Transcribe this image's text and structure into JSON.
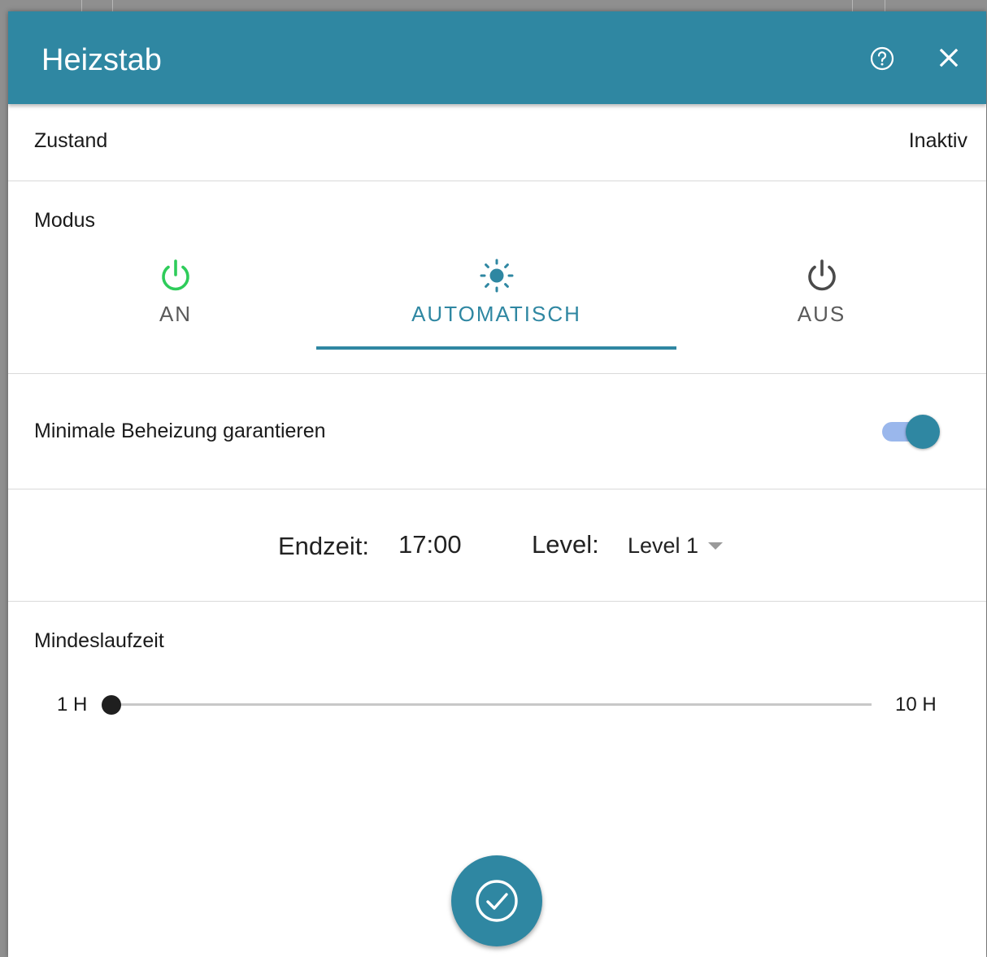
{
  "dialog": {
    "title": "Heizstab",
    "help_icon": "help-circle-icon",
    "close_icon": "close-icon"
  },
  "state": {
    "label": "Zustand",
    "value": "Inaktiv"
  },
  "mode": {
    "label": "Modus",
    "tabs": [
      {
        "label": "AN",
        "icon": "power-icon",
        "icon_color": "#2ecc5a"
      },
      {
        "label": "AUTOMATISCH",
        "icon": "sun-icon",
        "icon_color": "#2f87a2",
        "selected": true
      },
      {
        "label": "AUS",
        "icon": "power-icon",
        "icon_color": "#4a4a4a"
      }
    ]
  },
  "min_heating": {
    "label": "Minimale Beheizung garantieren",
    "enabled": true
  },
  "schedule": {
    "end_time_label": "Endzeit:",
    "end_time_value": "17:00",
    "level_label": "Level:",
    "level_value": "Level 1"
  },
  "min_runtime": {
    "label": "Mindeslaufzeit",
    "min_label": "1 H",
    "max_label": "10 H",
    "min": 1,
    "max": 10,
    "value": 1
  },
  "confirm": {
    "icon": "check-circle-icon"
  },
  "colors": {
    "accent": "#2f87a2",
    "toggle_track": "#9ab7ec",
    "on_green": "#2ecc5a"
  }
}
